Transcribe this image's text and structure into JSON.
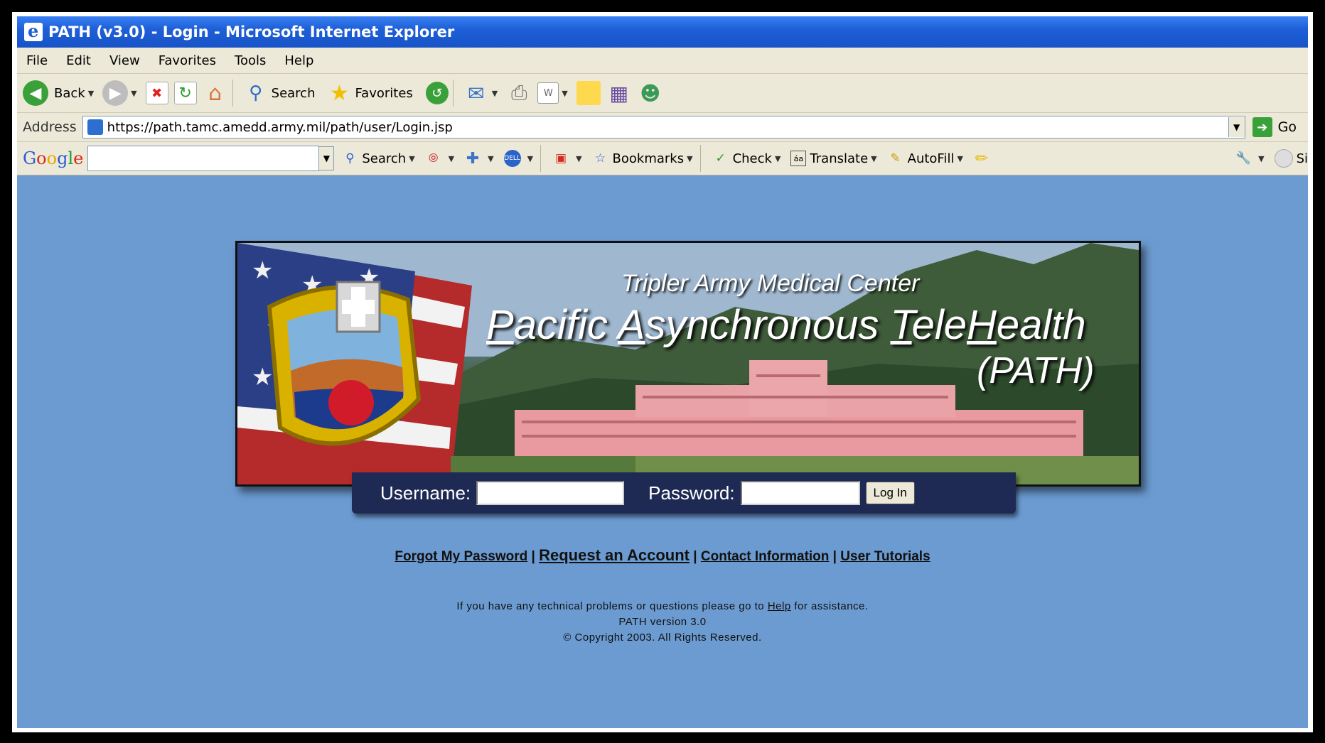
{
  "window": {
    "title": "PATH (v3.0) -  Login - Microsoft Internet Explorer"
  },
  "menubar": [
    "File",
    "Edit",
    "View",
    "Favorites",
    "Tools",
    "Help"
  ],
  "toolbar": {
    "back_label": "Back",
    "search_label": "Search",
    "favorites_label": "Favorites"
  },
  "address": {
    "label": "Address",
    "url": "https://path.tamc.amedd.army.mil/path/user/Login.jsp",
    "go_label": "Go"
  },
  "google_toolbar": {
    "logo": "Google",
    "search_label": "Search",
    "bookmarks_label": "Bookmarks",
    "check_label": "Check",
    "translate_label": "Translate",
    "autofill_label": "AutoFill",
    "signin_label": "Si"
  },
  "banner": {
    "subtitle": "Tripler Army Medical Center",
    "title_parts": [
      "P",
      "acific ",
      "A",
      "synchronous ",
      "T",
      "ele",
      "H",
      "ealth"
    ],
    "abbreviation": "(PATH)"
  },
  "login": {
    "username_label": "Username:",
    "password_label": "Password:",
    "username_value": "",
    "password_value": "",
    "submit_label": "Log In"
  },
  "links": {
    "forgot": "Forgot My Password",
    "request": "Request an Account",
    "contact": "Contact Information",
    "tutorials": "User Tutorials",
    "sep": "|"
  },
  "footer": {
    "help_pre": "If you have any technical problems or questions please go to ",
    "help_link": "Help",
    "help_post": " for assistance.",
    "version": "PATH version 3.0",
    "copyright": "© Copyright 2003. All Rights Reserved."
  }
}
